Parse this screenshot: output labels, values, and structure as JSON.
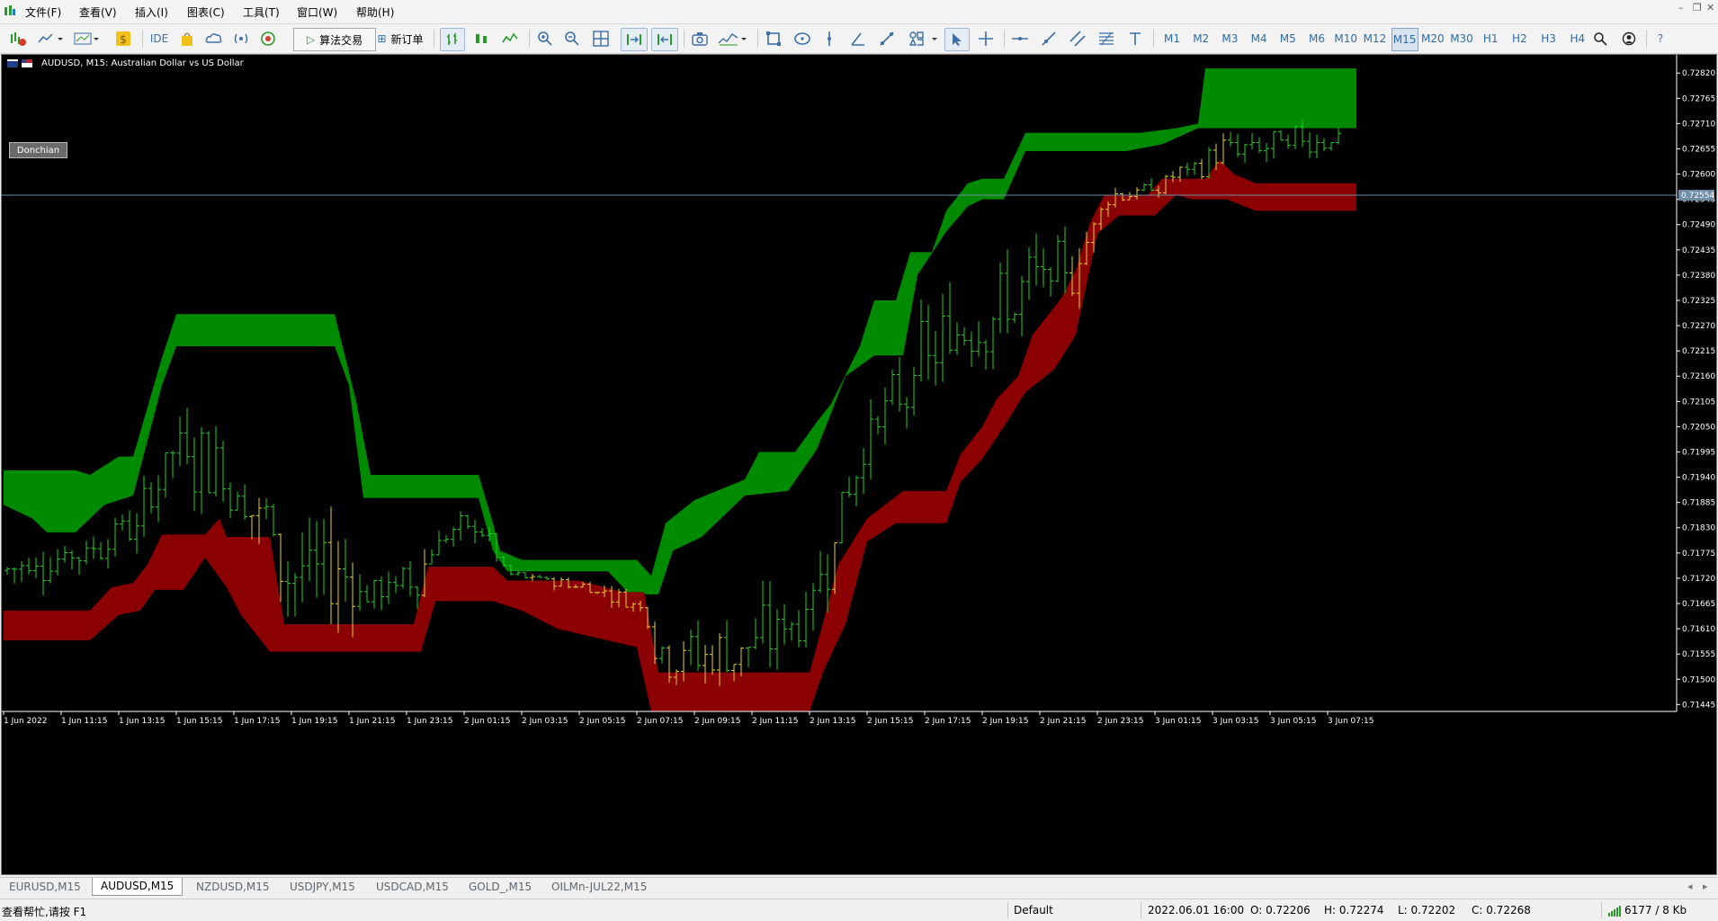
{
  "menu": [
    "文件(F)",
    "查看(V)",
    "插入(I)",
    "图表(C)",
    "工具(T)",
    "窗口(W)",
    "帮助(H)"
  ],
  "toolbar": {
    "ide": "IDE",
    "algo_trading": "算法交易",
    "new_order": "新订单",
    "timeframes": [
      "M1",
      "M2",
      "M3",
      "M4",
      "M5",
      "M6",
      "M10",
      "M12",
      "M15",
      "M20",
      "M30",
      "H1",
      "H2",
      "H3",
      "H4"
    ],
    "active_timeframe": "M15"
  },
  "chart": {
    "title": "AUDUSD, M15:  Australian Dollar vs US Dollar",
    "indicator_button": "Donchian",
    "current_price": "0.72554",
    "price_ticks": [
      "0.72820",
      "0.72765",
      "0.72710",
      "0.72655",
      "0.72600",
      "0.72545",
      "0.72490",
      "0.72435",
      "0.72380",
      "0.72325",
      "0.72270",
      "0.72215",
      "0.72160",
      "0.72105",
      "0.72050",
      "0.71995",
      "0.71940",
      "0.71885",
      "0.71830",
      "0.71775",
      "0.71720",
      "0.71665",
      "0.71610",
      "0.71555",
      "0.71500",
      "0.71445"
    ],
    "time_ticks": [
      "1 Jun 2022",
      "1 Jun 11:15",
      "1 Jun 13:15",
      "1 Jun 15:15",
      "1 Jun 17:15",
      "1 Jun 19:15",
      "1 Jun 21:15",
      "1 Jun 23:15",
      "2 Jun 01:15",
      "2 Jun 03:15",
      "2 Jun 05:15",
      "2 Jun 07:15",
      "2 Jun 09:15",
      "2 Jun 11:15",
      "2 Jun 13:15",
      "2 Jun 15:15",
      "2 Jun 17:15",
      "2 Jun 19:15",
      "2 Jun 21:15",
      "2 Jun 23:15",
      "3 Jun 01:15",
      "3 Jun 03:15",
      "3 Jun 05:15",
      "3 Jun 07:15"
    ],
    "colors": {
      "background": "#000000",
      "upper_band": "#008a00",
      "lower_band": "#8b0000",
      "bars": "#1fd01f",
      "bars_in_band": "#e6d418",
      "price_line": "#6f8ea8",
      "axis_text": "#ffffff"
    }
  },
  "chart_data": {
    "type": "line",
    "symbol": "AUDUSD",
    "ylim": [
      0.7143,
      0.7284
    ],
    "upper_band": {
      "top": [
        [
          0,
          0.71955
        ],
        [
          10,
          0.71955
        ],
        [
          12,
          0.71945
        ],
        [
          16,
          0.71985
        ],
        [
          18,
          0.71985
        ],
        [
          22,
          0.722
        ],
        [
          24,
          0.72295
        ],
        [
          46,
          0.72295
        ],
        [
          49,
          0.72105
        ],
        [
          51,
          0.71945
        ],
        [
          66,
          0.71945
        ],
        [
          68,
          0.7184
        ],
        [
          69,
          0.7178
        ],
        [
          72,
          0.7176
        ],
        [
          88,
          0.7176
        ],
        [
          90,
          0.71725
        ],
        [
          92,
          0.7184
        ],
        [
          96,
          0.7189
        ],
        [
          103,
          0.71935
        ],
        [
          105,
          0.71995
        ],
        [
          110,
          0.71995
        ],
        [
          113,
          0.7206
        ],
        [
          115,
          0.721
        ],
        [
          119,
          0.72225
        ],
        [
          121,
          0.72325
        ],
        [
          124,
          0.72325
        ],
        [
          126,
          0.7243
        ],
        [
          129,
          0.7243
        ],
        [
          131,
          0.7252
        ],
        [
          134,
          0.7258
        ],
        [
          136,
          0.7259
        ],
        [
          139,
          0.7259
        ],
        [
          142,
          0.7269
        ],
        [
          158,
          0.7269
        ],
        [
          163,
          0.727
        ],
        [
          166,
          0.7271
        ],
        [
          167,
          0.7283
        ],
        [
          188,
          0.7283
        ]
      ],
      "bottom": [
        [
          0,
          0.7188
        ],
        [
          4,
          0.7185
        ],
        [
          6,
          0.7182
        ],
        [
          10,
          0.7182
        ],
        [
          14,
          0.7188
        ],
        [
          18,
          0.719
        ],
        [
          22,
          0.7214
        ],
        [
          24,
          0.72225
        ],
        [
          46,
          0.72225
        ],
        [
          48,
          0.7214
        ],
        [
          50,
          0.71895
        ],
        [
          66,
          0.71895
        ],
        [
          68,
          0.7178
        ],
        [
          70,
          0.71735
        ],
        [
          84,
          0.71735
        ],
        [
          87,
          0.71685
        ],
        [
          91,
          0.71685
        ],
        [
          93,
          0.7178
        ],
        [
          97,
          0.7181
        ],
        [
          103,
          0.719
        ],
        [
          109,
          0.7191
        ],
        [
          113,
          0.72
        ],
        [
          117,
          0.7216
        ],
        [
          121,
          0.72205
        ],
        [
          125,
          0.72205
        ],
        [
          127,
          0.7238
        ],
        [
          131,
          0.72475
        ],
        [
          134,
          0.7253
        ],
        [
          136,
          0.72545
        ],
        [
          139,
          0.72545
        ],
        [
          142,
          0.7265
        ],
        [
          156,
          0.7265
        ],
        [
          161,
          0.72665
        ],
        [
          166,
          0.727
        ],
        [
          188,
          0.727
        ]
      ]
    },
    "lower_band": {
      "top": [
        [
          0,
          0.7165
        ],
        [
          12,
          0.7165
        ],
        [
          15,
          0.717
        ],
        [
          18,
          0.7171
        ],
        [
          20,
          0.7175
        ],
        [
          22,
          0.71815
        ],
        [
          28,
          0.71815
        ],
        [
          30,
          0.7185
        ],
        [
          31,
          0.7181
        ],
        [
          37,
          0.7181
        ],
        [
          39,
          0.7162
        ],
        [
          57,
          0.7162
        ],
        [
          59,
          0.71745
        ],
        [
          68,
          0.71745
        ],
        [
          70,
          0.71715
        ],
        [
          80,
          0.71715
        ],
        [
          86,
          0.7169
        ],
        [
          89,
          0.7169
        ],
        [
          91,
          0.71515
        ],
        [
          112,
          0.71515
        ],
        [
          114,
          0.7163
        ],
        [
          116,
          0.7175
        ],
        [
          120,
          0.7185
        ],
        [
          125,
          0.7191
        ],
        [
          131,
          0.7191
        ],
        [
          133,
          0.7199
        ],
        [
          136,
          0.7205
        ],
        [
          138,
          0.7211
        ],
        [
          141,
          0.7216
        ],
        [
          143,
          0.7225
        ],
        [
          147,
          0.7233
        ],
        [
          149,
          0.7239
        ],
        [
          151,
          0.72495
        ],
        [
          153,
          0.72555
        ],
        [
          159,
          0.72555
        ],
        [
          161,
          0.7259
        ],
        [
          167,
          0.7259
        ],
        [
          169,
          0.7263
        ],
        [
          171,
          0.726
        ],
        [
          174,
          0.7258
        ],
        [
          188,
          0.7258
        ]
      ],
      "bottom": [
        [
          0,
          0.71585
        ],
        [
          12,
          0.71585
        ],
        [
          16,
          0.7164
        ],
        [
          19,
          0.7165
        ],
        [
          21,
          0.71695
        ],
        [
          25,
          0.71695
        ],
        [
          28,
          0.71765
        ],
        [
          31,
          0.717
        ],
        [
          33,
          0.7164
        ],
        [
          37,
          0.7156
        ],
        [
          58,
          0.7156
        ],
        [
          60,
          0.7167
        ],
        [
          68,
          0.7167
        ],
        [
          72,
          0.7165
        ],
        [
          77,
          0.7161
        ],
        [
          88,
          0.7157
        ],
        [
          90,
          0.7143
        ],
        [
          112,
          0.7143
        ],
        [
          114,
          0.7152
        ],
        [
          117,
          0.7162
        ],
        [
          120,
          0.718
        ],
        [
          124,
          0.7184
        ],
        [
          131,
          0.7184
        ],
        [
          133,
          0.7193
        ],
        [
          136,
          0.7198
        ],
        [
          139,
          0.7205
        ],
        [
          142,
          0.72125
        ],
        [
          146,
          0.72175
        ],
        [
          149,
          0.7225
        ],
        [
          152,
          0.7247
        ],
        [
          155,
          0.7251
        ],
        [
          160,
          0.7251
        ],
        [
          163,
          0.72555
        ],
        [
          165,
          0.72545
        ],
        [
          170,
          0.72545
        ],
        [
          174,
          0.7252
        ],
        [
          188,
          0.7252
        ]
      ]
    },
    "bars_window": {
      "last_bar_index": 185,
      "bar_count": 186
    }
  },
  "tabs": [
    "EURUSD,M15",
    "AUDUSD,M15",
    "NZDUSD,M15",
    "USDJPY,M15",
    "USDCAD,M15",
    "GOLD_,M15",
    "OILMn-JUL22,M15"
  ],
  "active_tab": "AUDUSD,M15",
  "status": {
    "help": "查看帮忙,请按 F1",
    "profile": "Default",
    "datetime": "2022.06.01 16:00",
    "open": "O: 0.72206",
    "high": "H: 0.72274",
    "low": "L: 0.72202",
    "close": "C: 0.72268",
    "traffic": "6177 / 8 Kb"
  }
}
